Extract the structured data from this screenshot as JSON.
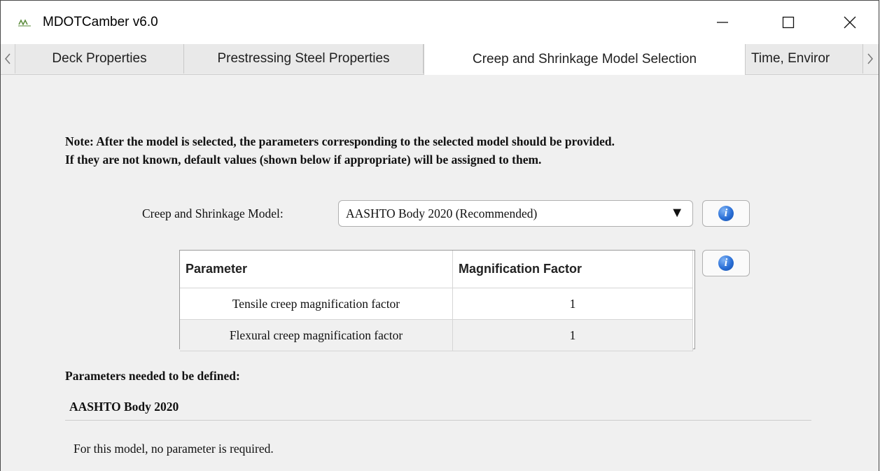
{
  "window": {
    "title": "MDOTCamber v6.0",
    "app_icon": "mdotcamber-logo-icon",
    "controls": [
      "minimize-icon",
      "maximize-icon",
      "close-icon"
    ]
  },
  "tabs": [
    {
      "label": "Deck Properties",
      "active": false
    },
    {
      "label": "Prestressing Steel Properties",
      "active": false
    },
    {
      "label": "Creep and Shrinkage Model Selection",
      "active": true
    },
    {
      "label": "Time, Enviror",
      "active": false
    }
  ],
  "note": {
    "line1": "Note: After the model is selected, the parameters corresponding to the selected model should be provided.",
    "line2": "If they are not known, default values (shown below if appropriate) will be assigned to them."
  },
  "model_select": {
    "label": "Creep and Shrinkage Model:",
    "value": "AASHTO Body 2020 (Recommended)",
    "arrow": "▼"
  },
  "info_icon": "i",
  "param_table": {
    "headers": [
      "Parameter",
      "Magnification Factor"
    ],
    "rows": [
      {
        "parameter": "Tensile creep magnification factor",
        "factor": "1"
      },
      {
        "parameter": "Flexural creep magnification factor",
        "factor": "1"
      }
    ]
  },
  "params_section": {
    "heading": "Parameters needed to be defined:",
    "model_name": "AASHTO Body 2020",
    "message": "For this model, no parameter is required."
  }
}
